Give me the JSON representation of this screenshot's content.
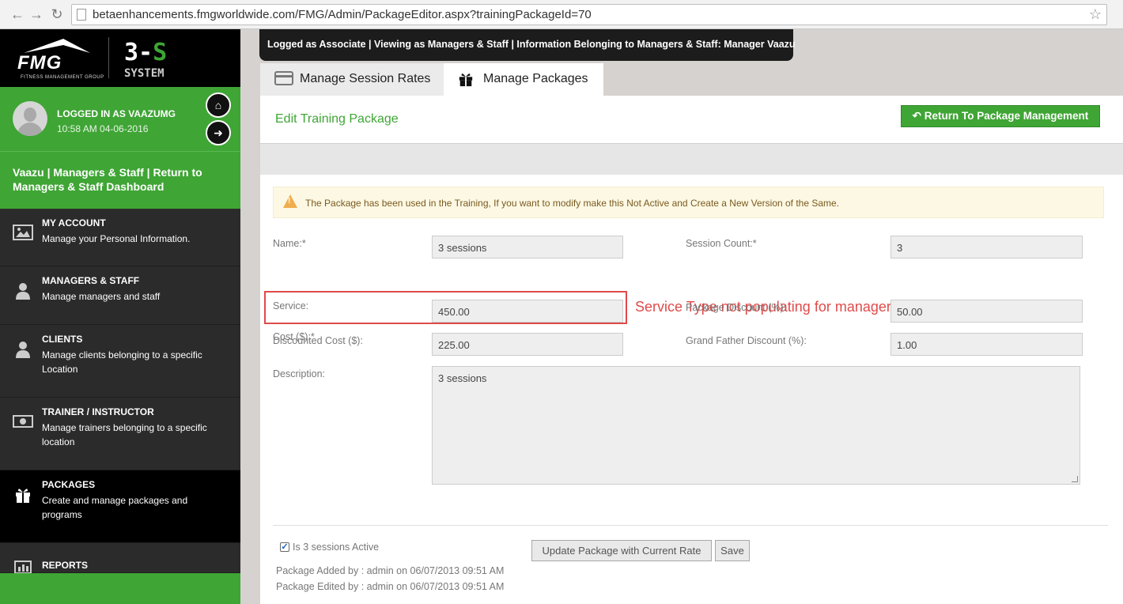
{
  "browser": {
    "url": "betaenhancements.fmgworldwide.com/FMG/Admin/PackageEditor.aspx?trainingPackageId=70"
  },
  "brand": {
    "logo": "FMG",
    "logo_sub": "FITNESS MANAGEMENT GROUP",
    "system_num_a": "3-",
    "system_num_b": "S",
    "system_label": "SYSTEM"
  },
  "user": {
    "logged_in": "LOGGED IN AS VAAZUMG",
    "timestamp": "10:58 AM 04-06-2016"
  },
  "context": {
    "text": "Vaazu  |  Managers & Staff  | Return to Managers & Staff Dashboard"
  },
  "menu": [
    {
      "title": "MY ACCOUNT",
      "desc": "Manage your Personal Information.",
      "icon": "image-icon"
    },
    {
      "title": "MANAGERS & STAFF",
      "desc": "Manage managers and staff",
      "icon": "user-tie-icon"
    },
    {
      "title": "CLIENTS",
      "desc": "Manage clients belonging to a specific Location",
      "icon": "user-icon"
    },
    {
      "title": "TRAINER / INSTRUCTOR",
      "desc": "Manage trainers belonging to a specific location",
      "icon": "money-icon"
    },
    {
      "title": "PACKAGES",
      "desc": "Create and manage packages and programs",
      "icon": "gift-icon"
    },
    {
      "title": "REPORTS",
      "desc": "",
      "icon": "bar-chart-icon"
    }
  ],
  "banner": "Logged as Associate | Viewing as Managers & Staff | Information Belonging to Managers & Staff: Manager Vaazu",
  "tabs": [
    {
      "label": "Manage Session Rates",
      "icon": "credit-card-icon"
    },
    {
      "label": "Manage Packages",
      "icon": "gift-icon"
    }
  ],
  "page": {
    "title": "Edit Training Package",
    "return_button": "Return To Package Management",
    "alert": "The Package has been used in the Training, If you want to modify make this Not Active and Create a New Version of the Same."
  },
  "form": {
    "name_label": "Name:*",
    "name_value": "3 sessions",
    "session_count_label": "Session Count:*",
    "session_count_value": "3",
    "service_label": "Service:",
    "cost_label": "Cost ($):*",
    "cost_value": "450.00",
    "package_discount_label": "Package Discount (%):",
    "package_discount_value": "50.00",
    "discounted_cost_label": "Discounted Cost ($):",
    "discounted_cost_value": "225.00",
    "grandfather_discount_label": "Grand Father Discount (%):",
    "grandfather_discount_value": "1.00",
    "description_label": "Description:",
    "description_value": "3 sessions",
    "active_label": "Is 3 sessions Active",
    "active_checked": true,
    "update_button": "Update Package with Current Rate",
    "save_button": "Save",
    "added": "Package Added by :  admin on 06/07/2013 09:51 AM",
    "edited": "Package Edited by :  admin on 06/07/2013 09:51 AM"
  },
  "annotation": "Service Type not populating for manager level access",
  "colors": {
    "brand_green": "#3fa535",
    "annotation_red": "#e04a4a",
    "alert_bg": "#fcf8e3",
    "sidebar_bg": "#2b2b2b"
  }
}
